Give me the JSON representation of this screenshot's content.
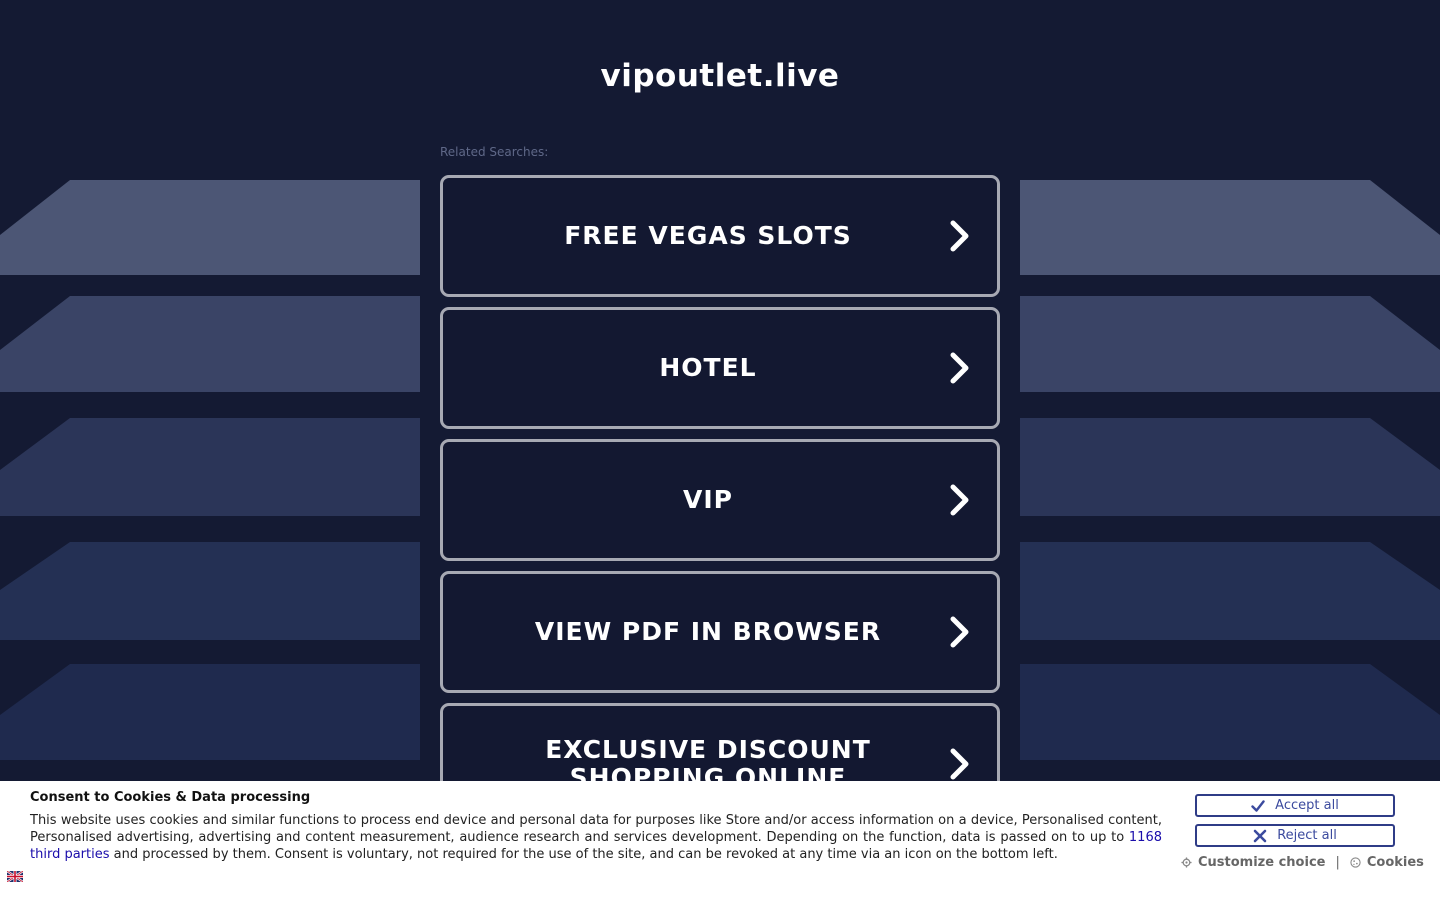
{
  "page": {
    "domain": "vipoutlet.live",
    "related_label": "Related Searches:"
  },
  "links": [
    {
      "label": "FREE VEGAS SLOTS"
    },
    {
      "label": "HOTEL"
    },
    {
      "label": "VIP"
    },
    {
      "label": "VIEW PDF IN BROWSER"
    },
    {
      "label": "EXCLUSIVE DISCOUNT SHOPPING ONLINE"
    }
  ],
  "consent": {
    "title": "Consent to Cookies & Data processing",
    "text_before": "This website uses cookies and similar functions to process end device and personal data for purposes like Store and/or access information on a device, Personalised content, Personalised advertising, advertising and content measurement, audience research and services development. Depending on the function, data is passed on to up to ",
    "link_text": "1168 third parties",
    "text_after": " and processed by them. Consent is voluntary, not required for the use of the site, and can be revoked at any time via an icon on the bottom left.",
    "accept_label": "Accept all",
    "reject_label": "Reject all",
    "customize_label": "Customize choice",
    "separator": "|",
    "cookies_label": "Cookies",
    "flag_icon": "uk-flag-icon"
  },
  "colors": {
    "background": "#141a33",
    "button_border": "#a7a9b3",
    "consent_button": "#2f3c87"
  }
}
